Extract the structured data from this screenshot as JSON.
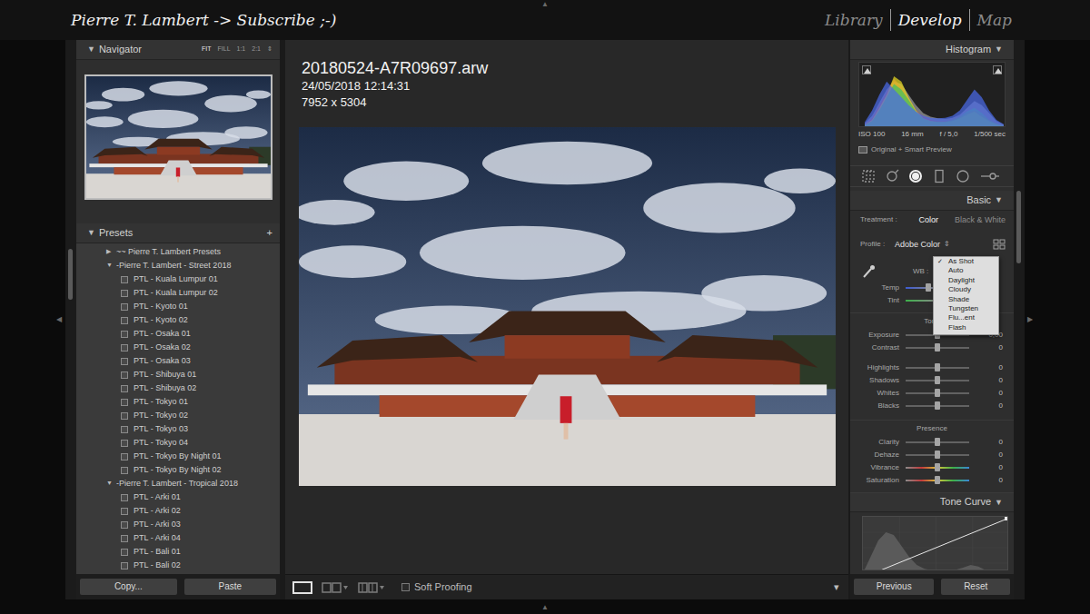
{
  "top_bar": {
    "title": "Pierre T. Lambert -> Subscribe ;-)",
    "modules": [
      {
        "label": "Library",
        "selected": false
      },
      {
        "label": "Develop",
        "selected": true
      },
      {
        "label": "Map",
        "selected": false
      }
    ]
  },
  "edge_arrows": {
    "left": "◀",
    "right": "▶",
    "top": "▲",
    "bottom": "▲"
  },
  "navigator": {
    "toggle": "▼",
    "title": "Navigator",
    "zoom": [
      {
        "label": "FIT",
        "selected": true
      },
      {
        "label": "FILL",
        "selected": false
      },
      {
        "label": "1:1",
        "selected": false
      },
      {
        "label": "2:1",
        "selected": false
      }
    ],
    "zoom_more": "⇕"
  },
  "presets": {
    "toggle": "▼",
    "title": "Presets",
    "add": "+",
    "expand_glyphs": {
      "expanded": "▼",
      "collapsed": "▶"
    },
    "groups": [
      {
        "label": "~~ Pierre T. Lambert Presets",
        "expanded": false,
        "items": []
      },
      {
        "label": "-Pierre T. Lambert - Street 2018",
        "expanded": true,
        "items": [
          "PTL - Kuala Lumpur 01",
          "PTL - Kuala Lumpur 02",
          "PTL - Kyoto 01",
          "PTL - Kyoto 02",
          "PTL - Osaka 01",
          "PTL - Osaka 02",
          "PTL - Osaka 03",
          "PTL - Shibuya 01",
          "PTL - Shibuya 02",
          "PTL - Tokyo 01",
          "PTL - Tokyo 02",
          "PTL - Tokyo 03",
          "PTL - Tokyo 04",
          "PTL - Tokyo By Night 01",
          "PTL - Tokyo By Night 02"
        ]
      },
      {
        "label": "-Pierre T. Lambert - Tropical 2018",
        "expanded": true,
        "items": [
          "PTL - Arki 01",
          "PTL - Arki 02",
          "PTL - Arki 03",
          "PTL - Arki 04",
          "PTL - Bali 01",
          "PTL - Bali 02"
        ]
      }
    ]
  },
  "left_buttons": [
    "Copy...",
    "Paste"
  ],
  "image_info": {
    "filename": "20180524-A7R09697.arw",
    "datetime": "24/05/2018 12:14:31",
    "dimensions": "7952 x 5304"
  },
  "toolbar": {
    "views": [
      {
        "kind": "loupe",
        "selected": true
      },
      {
        "kind": "before-after",
        "selected": false
      },
      {
        "kind": "before-after-split",
        "selected": false
      }
    ],
    "soft_proofing": {
      "label": "Soft Proofing",
      "checked": false
    },
    "menu": "▾"
  },
  "histogram": {
    "title": "Histogram",
    "toggle": "▼",
    "series": [
      {
        "color": "#9a9a9a",
        "values": [
          5,
          20,
          45,
          70,
          85,
          80,
          60,
          40,
          25,
          18,
          15,
          14,
          16,
          22,
          35,
          48,
          40,
          25,
          10,
          3
        ]
      },
      {
        "color": "#d04040",
        "values": [
          3,
          15,
          40,
          65,
          90,
          75,
          50,
          30,
          18,
          12,
          10,
          10,
          12,
          18,
          25,
          30,
          22,
          12,
          5,
          1
        ]
      },
      {
        "color": "#e6d820",
        "values": [
          2,
          12,
          35,
          60,
          95,
          85,
          55,
          30,
          15,
          10,
          8,
          8,
          10,
          15,
          22,
          28,
          18,
          10,
          4,
          1
        ]
      },
      {
        "color": "#40c060",
        "values": [
          2,
          10,
          30,
          55,
          80,
          70,
          50,
          28,
          15,
          10,
          9,
          9,
          12,
          18,
          28,
          35,
          25,
          12,
          5,
          1
        ]
      },
      {
        "color": "#4a6ae8",
        "values": [
          8,
          30,
          60,
          85,
          70,
          55,
          40,
          28,
          20,
          16,
          15,
          16,
          20,
          30,
          50,
          70,
          55,
          30,
          12,
          4
        ]
      }
    ],
    "exif": [
      "ISO 100",
      "16 mm",
      "f / 5,0",
      "1/500 sec"
    ],
    "preview": "Original + Smart Preview"
  },
  "tools": [
    {
      "kind": "crop",
      "selected": false
    },
    {
      "kind": "spot",
      "selected": false
    },
    {
      "kind": "red-eye",
      "selected": true
    },
    {
      "kind": "graduated",
      "selected": false
    },
    {
      "kind": "radial",
      "selected": false
    },
    {
      "kind": "brush",
      "selected": false
    }
  ],
  "basic": {
    "title": "Basic",
    "toggle": "▼",
    "treatment": {
      "label": "Treatment :",
      "options": [
        {
          "label": "Color",
          "selected": true
        },
        {
          "label": "Black & White",
          "selected": false
        }
      ]
    },
    "profile": {
      "label": "Profile :",
      "value": "Adobe Color",
      "arrow": "⇕"
    },
    "wb": {
      "label": "WB :",
      "check": "✓",
      "menu": [
        {
          "label": "As Shot",
          "selected": true
        },
        {
          "label": "Auto",
          "selected": false
        },
        {
          "label": "Daylight",
          "selected": false
        },
        {
          "label": "Cloudy",
          "selected": false
        },
        {
          "label": "Shade",
          "selected": false
        },
        {
          "label": "Tungsten",
          "selected": false
        },
        {
          "label": "Flu...ent",
          "selected": false
        },
        {
          "label": "Flash",
          "selected": false
        }
      ]
    },
    "wb_sliders": [
      {
        "label": "Temp",
        "level": 0.35,
        "kind": "temp"
      },
      {
        "label": "Tint",
        "level": 0.5,
        "kind": "tint"
      }
    ],
    "groups": [
      {
        "title": "Tone",
        "sliders": [
          {
            "label": "Exposure",
            "value": "0,00",
            "level": 0.5,
            "kind": "plain"
          },
          {
            "label": "Contrast",
            "value": "0",
            "level": 0.5,
            "kind": "plain"
          },
          {
            "label": "Highlights",
            "value": "0",
            "level": 0.5,
            "kind": "plain"
          },
          {
            "label": "Shadows",
            "value": "0",
            "level": 0.5,
            "kind": "plain"
          },
          {
            "label": "Whites",
            "value": "0",
            "level": 0.5,
            "kind": "plain"
          },
          {
            "label": "Blacks",
            "value": "0",
            "level": 0.5,
            "kind": "plain"
          }
        ]
      },
      {
        "title": "Presence",
        "sliders": [
          {
            "label": "Clarity",
            "value": "0",
            "level": 0.5,
            "kind": "plain"
          },
          {
            "label": "Dehaze",
            "value": "0",
            "level": 0.5,
            "kind": "plain"
          },
          {
            "label": "Vibrance",
            "value": "0",
            "level": 0.5,
            "kind": "color"
          },
          {
            "label": "Saturation",
            "value": "0",
            "level": 0.5,
            "kind": "color"
          }
        ]
      }
    ]
  },
  "tone_curve": {
    "title": "Tone Curve",
    "toggle": "▼",
    "histogram": [
      10,
      40,
      70,
      85,
      80,
      60,
      40,
      25,
      18,
      15,
      14,
      14,
      16,
      20,
      25,
      22,
      15,
      8,
      4,
      2
    ],
    "curve": [
      [
        0,
        0
      ],
      [
        100,
        100
      ]
    ]
  },
  "right_buttons": [
    "Previous",
    "Reset"
  ]
}
